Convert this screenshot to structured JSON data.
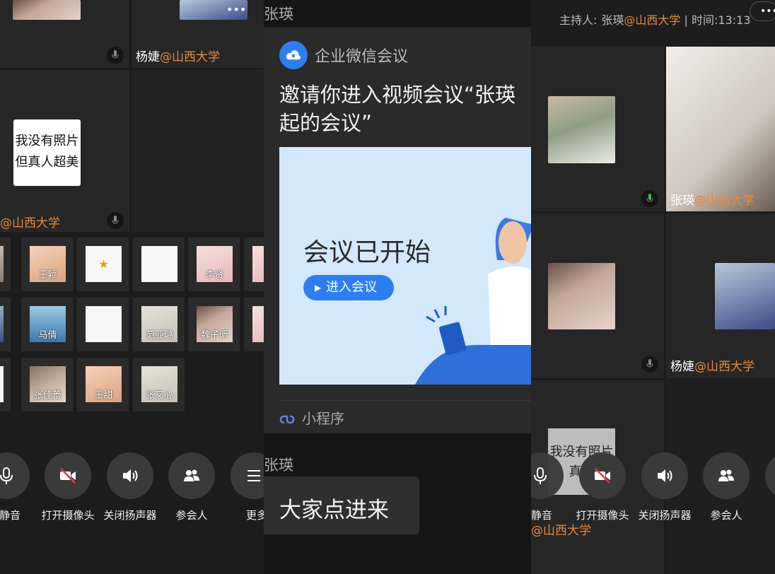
{
  "left": {
    "top_participant": {
      "name": "杨婕",
      "org": "@山西大学"
    },
    "selfie_card": {
      "line1": "我没有照片",
      "line2": "但真人超美"
    },
    "bottom_participant": {
      "org": "@山西大学"
    },
    "grid": [
      {
        "label": ""
      },
      {
        "label": "王颖"
      },
      {
        "label": ""
      },
      {
        "label": ""
      },
      {
        "label": "李贤"
      },
      {
        "label": ""
      },
      {
        "label": ""
      },
      {
        "label": "马倩"
      },
      {
        "label": ""
      },
      {
        "label": "范亚璐"
      },
      {
        "label": "魏子昕"
      },
      {
        "label": ""
      },
      {
        "label": ""
      },
      {
        "label": "张佳蕾"
      },
      {
        "label": "王甜"
      },
      {
        "label": "张又心"
      }
    ]
  },
  "toolbar": {
    "mute": "静音",
    "camera": "打开摄像头",
    "speaker": "关闭扬声器",
    "participants": "参会人",
    "more": "更多"
  },
  "chat": {
    "sender1": "张瑛",
    "card": {
      "app_name": "企业微信会议",
      "invite_line1": "邀请你进入视频会议“张瑛",
      "invite_line2": "起的会议”",
      "banner_title": "会议已开始",
      "banner_button": "进入会议",
      "footer": "小程序"
    },
    "sender2": "张瑛",
    "message": "大家点进来"
  },
  "right": {
    "header": {
      "host_label": "主持人:",
      "host_name": "张瑛",
      "host_org": "@山西大学",
      "sep": " | ",
      "time_label": "时间:",
      "time": "13:13"
    },
    "p1": {
      "name": "张瑛",
      "org": "@山西大学"
    },
    "p2": {
      "name": "杨婕",
      "org": "@山西大学"
    },
    "selfie_card": {
      "line1": "我没有照片",
      "line2": "真人"
    },
    "bottom_org": "@山西大学"
  },
  "colors": {
    "org_orange": "#e6893a",
    "accent_blue": "#2d7ff0",
    "banner_bg": "#d3e8fb"
  }
}
